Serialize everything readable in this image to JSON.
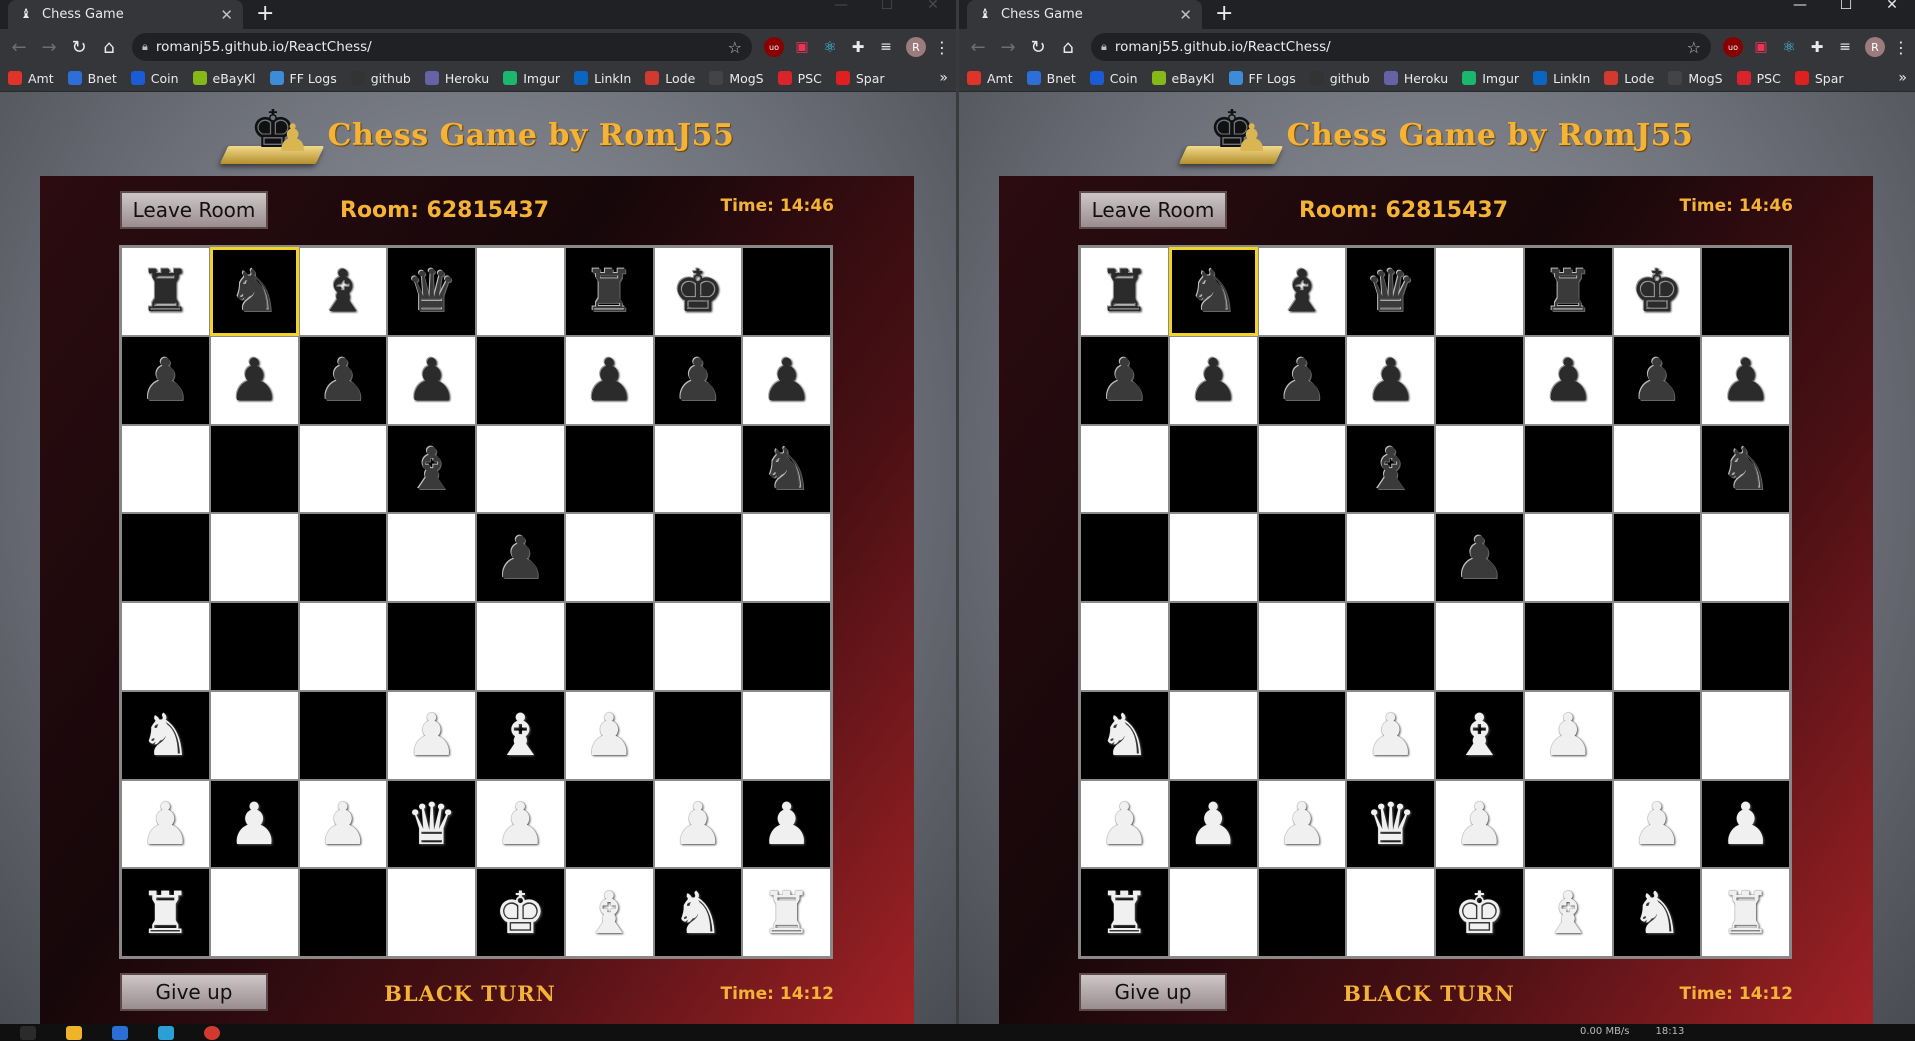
{
  "browser": {
    "tab_title": "Chess Game",
    "url": "romanj55.github.io/ReactChess/",
    "avatar_letter": "R",
    "bookmarks": [
      {
        "label": "Amt",
        "icon": "amt-icon",
        "color": "#e0342a"
      },
      {
        "label": "Bnet",
        "icon": "bnet-icon",
        "color": "#2c6fd6"
      },
      {
        "label": "Coin",
        "icon": "coin-icon",
        "color": "#1a5bd6"
      },
      {
        "label": "eBayKl",
        "icon": "ebay-icon",
        "color": "#86b817"
      },
      {
        "label": "FF Logs",
        "icon": "fflogs-icon",
        "color": "#3c8cd8"
      },
      {
        "label": "github",
        "icon": "github-icon",
        "color": "#333333"
      },
      {
        "label": "Heroku",
        "icon": "heroku-icon",
        "color": "#6762a6"
      },
      {
        "label": "Imgur",
        "icon": "imgur-icon",
        "color": "#1bb76e"
      },
      {
        "label": "LinkIn",
        "icon": "linkedin-icon",
        "color": "#0a66c2"
      },
      {
        "label": "Lode",
        "icon": "lode-icon",
        "color": "#d2392f"
      },
      {
        "label": "MogS",
        "icon": "mogs-icon",
        "color": "#444444"
      },
      {
        "label": "PSC",
        "icon": "psc-icon",
        "color": "#d9242e"
      },
      {
        "label": "Spar",
        "icon": "spar-icon",
        "color": "#e02020"
      }
    ]
  },
  "game": {
    "title": "Chess Game by RomJ55",
    "leave_label": "Leave Room",
    "room_label": "Room: 62815437",
    "time_top": "Time: 14:46",
    "give_up_label": "Give up",
    "turn_label": "BLACK TURN",
    "time_bottom": "Time: 14:12",
    "selected_square": [
      0,
      1
    ],
    "board": [
      [
        "br",
        "bn",
        "bb",
        "bq",
        "",
        "br",
        "bk",
        ""
      ],
      [
        "bp",
        "bp",
        "bp",
        "bp",
        "",
        "bp",
        "bp",
        "bp"
      ],
      [
        "",
        "",
        "",
        "bb",
        "",
        "",
        "",
        "bn"
      ],
      [
        "",
        "",
        "",
        "",
        "bp",
        "",
        "",
        ""
      ],
      [
        "",
        "",
        "",
        "",
        "",
        "",
        "",
        ""
      ],
      [
        "wn",
        "",
        "",
        "wp",
        "wb",
        "wp",
        "",
        ""
      ],
      [
        "wp",
        "wp",
        "wp",
        "wq",
        "wp",
        "",
        "wp",
        "wp"
      ],
      [
        "wr",
        "",
        "",
        "",
        "wk",
        "wb",
        "wn",
        "wr"
      ]
    ]
  },
  "taskbar": {
    "net_speed": "0.00 MB/s",
    "clock": "18:13"
  }
}
